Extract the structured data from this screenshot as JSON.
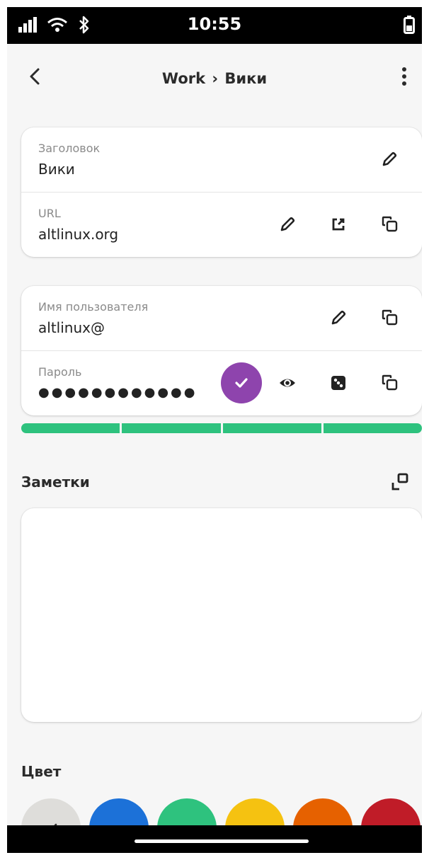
{
  "status_bar": {
    "time": "10:55"
  },
  "header": {
    "workspace": "Work",
    "separator": "›",
    "page": "Вики"
  },
  "credentials_card": {
    "title_label": "Заголовок",
    "title_value": "Вики",
    "url_label": "URL",
    "url_value": "altlinux.org"
  },
  "login_card": {
    "username_label": "Имя пользователя",
    "username_value": "altlinux@",
    "password_label": "Пароль",
    "password_value": "●●●●●●●●●●●●"
  },
  "password_strength": {
    "filled_segments": 4,
    "total_segments": 4,
    "color": "#2ec27e"
  },
  "notes": {
    "label": "Заметки",
    "content": ""
  },
  "color_section": {
    "label": "Цвет",
    "swatches": [
      "#deddda",
      "#1c71d8",
      "#2ec27e",
      "#f5c211",
      "#e66100",
      "#c01c28"
    ],
    "selected_index": 0
  },
  "accent": "#8e44ad"
}
